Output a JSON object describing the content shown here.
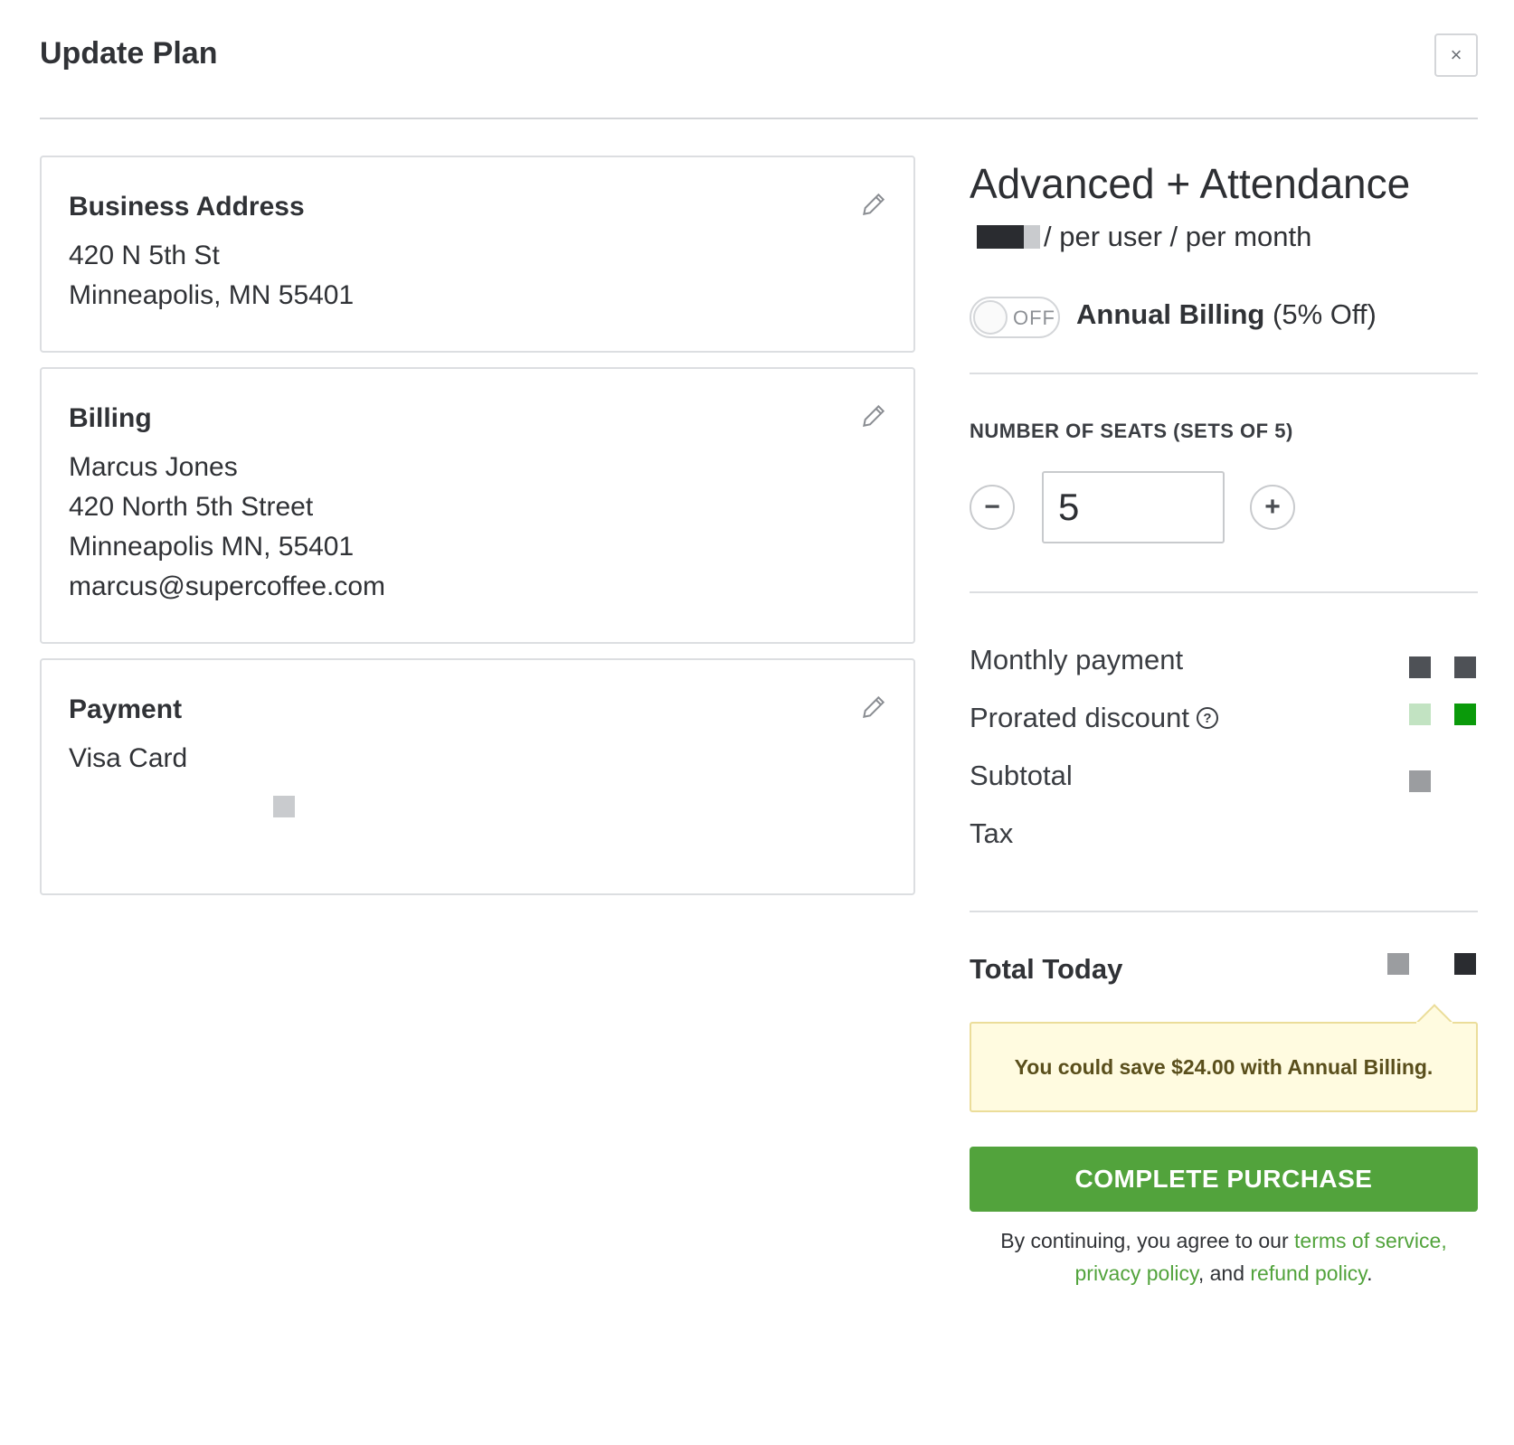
{
  "modal": {
    "title": "Update Plan",
    "close_label": "×"
  },
  "cards": {
    "business_address": {
      "title": "Business Address",
      "lines": [
        "420 N 5th St",
        "Minneapolis, MN 55401"
      ]
    },
    "billing": {
      "title": "Billing",
      "lines": [
        "Marcus Jones",
        "420 North 5th Street",
        "Minneapolis MN, 55401",
        "marcus@supercoffee.com"
      ]
    },
    "payment": {
      "title": "Payment",
      "lines": [
        "Visa Card"
      ]
    }
  },
  "plan": {
    "name": "Advanced + Attendance",
    "price_suffix": "/ per user / per month",
    "annual_toggle_state": "OFF",
    "annual_label": "Annual Billing",
    "annual_discount": "(5% Off)"
  },
  "seats": {
    "label": "NUMBER OF SEATS (SETS OF 5)",
    "value": "5",
    "minus": "−",
    "plus": "+"
  },
  "summary": {
    "monthly_payment": "Monthly payment",
    "prorated_discount": "Prorated discount",
    "help_glyph": "?",
    "subtotal": "Subtotal",
    "tax": "Tax",
    "total_today": "Total Today"
  },
  "notice": {
    "text": "You could save $24.00 with Annual Billing."
  },
  "purchase": {
    "label": "COMPLETE PURCHASE"
  },
  "legal": {
    "prefix": "By continuing, you agree to our ",
    "terms": "terms of service,",
    "privacy": "privacy policy",
    "middle": ", and ",
    "refund": "refund policy",
    "suffix": "."
  },
  "colors": {
    "accent_green": "#52a33c",
    "discount_green": "#0a9a0a",
    "discount_green_light": "#c2e3c2",
    "dark_mask": "#2a2c30",
    "mid_mask": "#4e5156",
    "gray_mask": "#9b9da0",
    "light_mask": "#c9cbce"
  }
}
